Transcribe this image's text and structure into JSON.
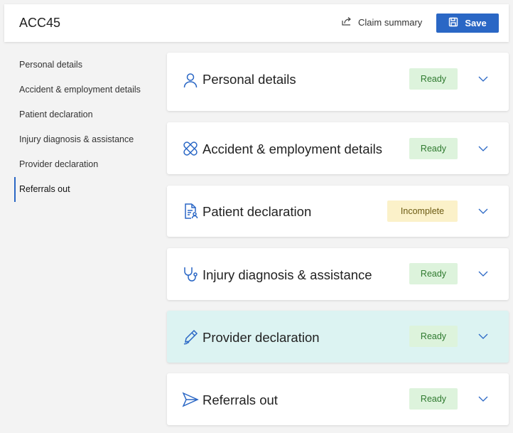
{
  "header": {
    "title": "ACC45",
    "claim_summary_label": "Claim summary",
    "save_label": "Save"
  },
  "sidenav": {
    "items": [
      {
        "label": "Personal details"
      },
      {
        "label": "Accident & employment details"
      },
      {
        "label": "Patient declaration"
      },
      {
        "label": "Injury diagnosis & assistance"
      },
      {
        "label": "Provider declaration"
      },
      {
        "label": "Referrals out",
        "active": true
      }
    ]
  },
  "sections": [
    {
      "title": "Personal details",
      "status": "Ready",
      "icon": "person-icon"
    },
    {
      "title": "Accident & employment details",
      "status": "Ready",
      "icon": "bandage-icon"
    },
    {
      "title": "Patient declaration",
      "status": "Incomplete",
      "icon": "document-person-icon"
    },
    {
      "title": "Injury diagnosis & assistance",
      "status": "Ready",
      "icon": "stethoscope-icon"
    },
    {
      "title": "Provider declaration",
      "status": "Ready",
      "icon": "signature-pen-icon",
      "highlighted": true
    },
    {
      "title": "Referrals out",
      "status": "Ready",
      "icon": "send-icon"
    }
  ],
  "colors": {
    "accent": "#2a67c5",
    "ready_bg": "#ddf3dc",
    "ready_text": "#2f7a2f",
    "incomplete_bg": "#fbf1c9",
    "incomplete_text": "#6b5a12",
    "highlight_bg": "#dcf3f2"
  }
}
